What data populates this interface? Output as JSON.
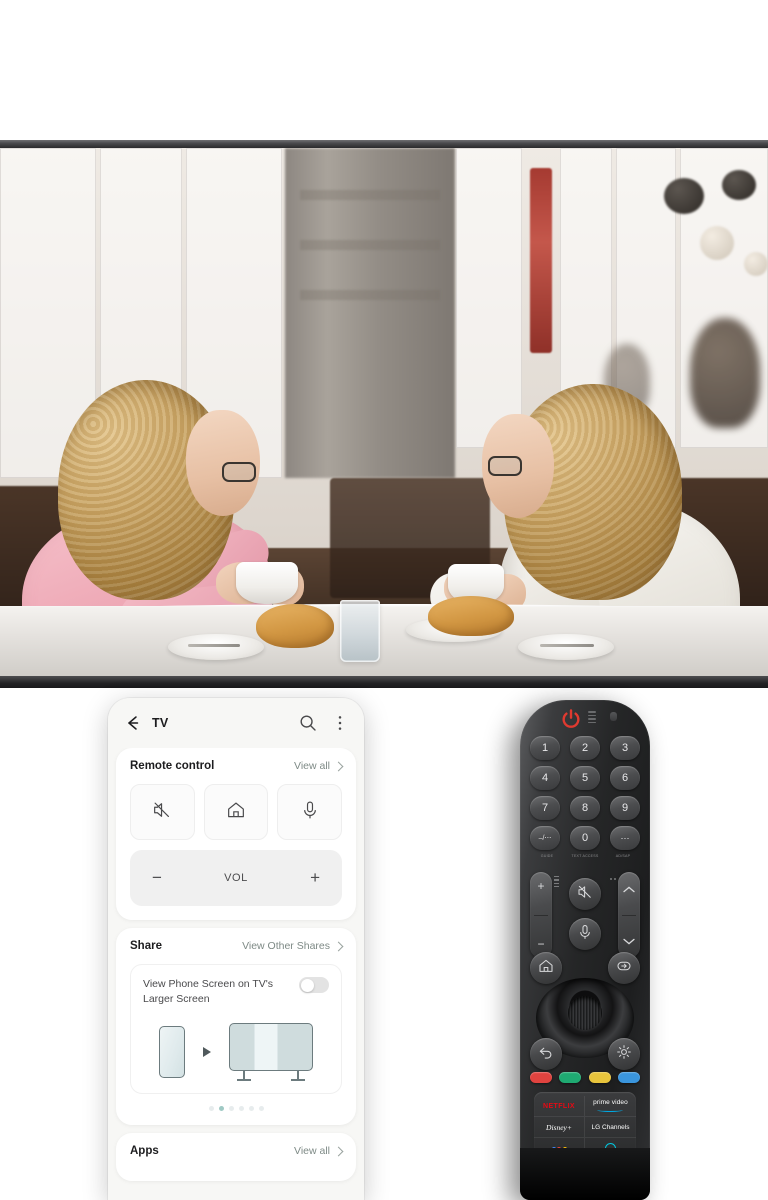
{
  "tv": {
    "scene_description": "Two women chatting over coffee at a cafe counter"
  },
  "phone": {
    "topbar": {
      "back_icon": "arrow-left-icon",
      "title": "TV",
      "search_icon": "search-icon",
      "more_icon": "more-vertical-icon"
    },
    "remote_control": {
      "title": "Remote control",
      "view_all_label": "View all",
      "buttons": [
        {
          "name": "mute-button",
          "icon": "mute-icon"
        },
        {
          "name": "home-button",
          "icon": "home-icon"
        },
        {
          "name": "mic-button",
          "icon": "microphone-icon"
        }
      ],
      "volume": {
        "minus_label": "−",
        "label": "VOL",
        "plus_label": "+"
      }
    },
    "share": {
      "title": "Share",
      "view_other_label": "View Other Shares",
      "item_text": "View Phone Screen on TV's Larger Screen",
      "toggle_state": "off",
      "illustration": {
        "source_icon": "phone-icon",
        "arrow_icon": "play-arrow-icon",
        "target_icon": "tv-icon"
      },
      "page_dots": {
        "count": 6,
        "active_index": 1
      }
    },
    "apps": {
      "title": "Apps",
      "view_all_label": "View all"
    }
  },
  "remote": {
    "power_icon": "power-icon",
    "power_color": "#e03a30",
    "keypad": [
      {
        "label": "1",
        "caption": ""
      },
      {
        "label": "2",
        "caption": ""
      },
      {
        "label": "3",
        "caption": ""
      },
      {
        "label": "4",
        "caption": ""
      },
      {
        "label": "5",
        "caption": ""
      },
      {
        "label": "6",
        "caption": ""
      },
      {
        "label": "7",
        "caption": ""
      },
      {
        "label": "8",
        "caption": ""
      },
      {
        "label": "9",
        "caption": ""
      }
    ],
    "bottom_row": [
      {
        "label": "–/⋯",
        "caption": "GUIDE"
      },
      {
        "label": "0",
        "caption": "TEXT\nACCESS"
      },
      {
        "label": "⋯",
        "caption": "AD/SAP"
      }
    ],
    "rockers": {
      "volume_up": "+",
      "volume_down": "−",
      "channel_up": "chevron-up-icon",
      "channel_down": "chevron-down-icon"
    },
    "center_buttons": [
      {
        "name": "mute-button",
        "icon": "mute-icon"
      },
      {
        "name": "mic-button",
        "icon": "microphone-icon"
      }
    ],
    "side_buttons": [
      {
        "name": "home-button",
        "icon": "home-icon"
      },
      {
        "name": "input-button",
        "icon": "input-source-icon"
      },
      {
        "name": "back-button",
        "icon": "back-arrow-icon"
      },
      {
        "name": "settings-button",
        "icon": "gear-icon"
      }
    ],
    "wheel": {
      "name": "scroll-wheel"
    },
    "color_keys": [
      {
        "name": "red-key",
        "color": "#e0433f"
      },
      {
        "name": "green-key",
        "color": "#1faa72"
      },
      {
        "name": "yellow-key",
        "color": "#e8c43c"
      },
      {
        "name": "blue-key",
        "color": "#3a95dd"
      }
    ],
    "app_keys": [
      {
        "name": "netflix-key",
        "label": "NETFLIX"
      },
      {
        "name": "prime-video-key",
        "label": "prime video"
      },
      {
        "name": "disney-plus-key",
        "label": "Disney+"
      },
      {
        "name": "lg-channels-key",
        "label": "LG Channels"
      },
      {
        "name": "google-assistant-key",
        "label": ""
      },
      {
        "name": "alexa-key",
        "label": ""
      }
    ]
  }
}
